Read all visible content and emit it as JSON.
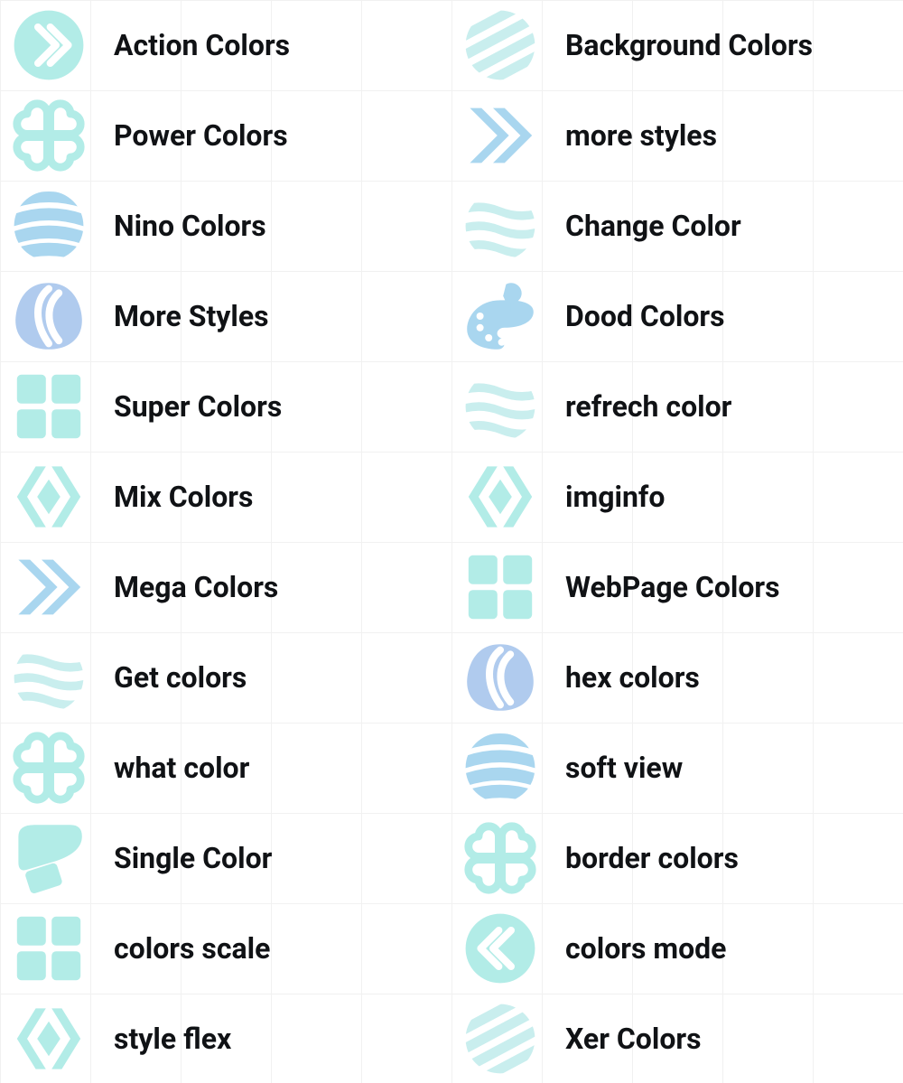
{
  "grid": {
    "cell_size_px": 100
  },
  "palette": {
    "teal": "#b2ece7",
    "mint": "#c9eeee",
    "sky": "#a9d6ef",
    "blue": "#b0cbee",
    "text": "#101215",
    "gridline": "#e9e9e9"
  },
  "items": [
    {
      "label": "Action Colors",
      "icon": "arrow-forward-circle-icon",
      "tint": "teal"
    },
    {
      "label": "Background Colors",
      "icon": "stripes-diagonal-circle-icon",
      "tint": "mint"
    },
    {
      "label": "Power Colors",
      "icon": "clover-icon",
      "tint": "teal"
    },
    {
      "label": "more styles",
      "icon": "chevrons-right-icon",
      "tint": "sky"
    },
    {
      "label": "Nino Colors",
      "icon": "stripes-sphere-icon",
      "tint": "sky"
    },
    {
      "label": "Change Color",
      "icon": "waves-circle-icon",
      "tint": "mint"
    },
    {
      "label": "More Styles",
      "icon": "leaf-swirl-icon",
      "tint": "blue"
    },
    {
      "label": "Dood Colors",
      "icon": "paint-palette-icon",
      "tint": "sky"
    },
    {
      "label": "Super Colors",
      "icon": "four-squares-icon",
      "tint": "teal"
    },
    {
      "label": "refrech color",
      "icon": "waves-circle-icon",
      "tint": "mint"
    },
    {
      "label": "Mix Colors",
      "icon": "diamond-brackets-icon",
      "tint": "teal"
    },
    {
      "label": "imginfo",
      "icon": "diamond-brackets-icon",
      "tint": "teal"
    },
    {
      "label": "Mega Colors",
      "icon": "chevrons-right-icon",
      "tint": "sky"
    },
    {
      "label": "WebPage Colors",
      "icon": "four-squares-icon",
      "tint": "teal"
    },
    {
      "label": "Get colors",
      "icon": "waves-circle-icon",
      "tint": "mint"
    },
    {
      "label": "hex colors",
      "icon": "leaf-swirl-icon",
      "tint": "blue"
    },
    {
      "label": "what color",
      "icon": "clover-icon",
      "tint": "teal"
    },
    {
      "label": "soft view",
      "icon": "stripes-sphere-icon",
      "tint": "sky"
    },
    {
      "label": "Single Color",
      "icon": "paint-roller-icon",
      "tint": "teal"
    },
    {
      "label": "border colors",
      "icon": "clover-icon",
      "tint": "teal"
    },
    {
      "label": "colors scale",
      "icon": "four-squares-icon",
      "tint": "teal"
    },
    {
      "label": "colors mode",
      "icon": "arrow-back-circle-icon",
      "tint": "teal"
    },
    {
      "label": "style flex",
      "icon": "diamond-brackets-icon",
      "tint": "teal"
    },
    {
      "label": "Xer Colors",
      "icon": "stripes-diagonal-circle-icon",
      "tint": "mint"
    }
  ]
}
